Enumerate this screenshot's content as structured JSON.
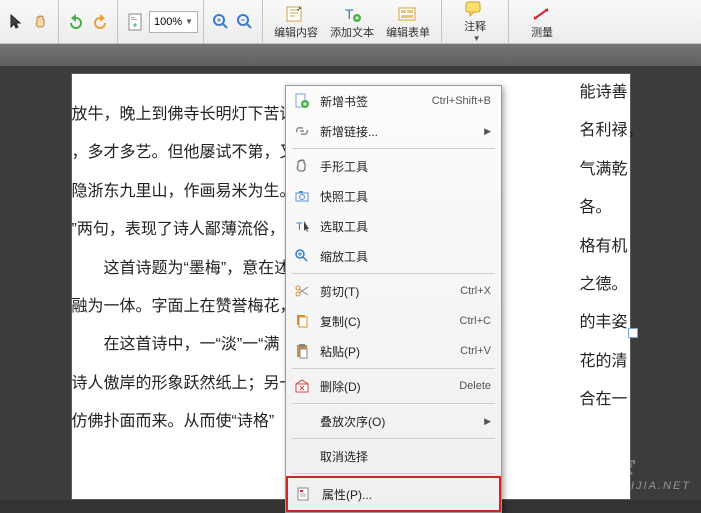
{
  "toolbar": {
    "zoom_value": "100%",
    "edit_content": "编辑内容",
    "add_text": "添加文本",
    "edit_form": "编辑表单",
    "annotate": "注释",
    "measure": "测量"
  },
  "document": {
    "lines": [
      "放牛，晚上到佛寺长明灯下苦读",
      "，多才多艺。但他屡试不第，又不",
      "隐浙东九里山，作画易米为生。",
      "”两句，表现了诗人鄙薄流俗，",
      "　　这首诗题为“墨梅”，意在述",
      "融为一体。字面上在赞誉梅花，",
      "　　在这首诗中，一“淡”一“满",
      "诗人傲岸的形象跃然纸上；另一",
      "仿佛扑面而来。从而使“诗格”"
    ],
    "tails": [
      "能诗善",
      "名利禄，",
      "气满乾",
      "各。",
      "格有机",
      "之德。",
      "的丰姿",
      "花的清",
      "合在一"
    ]
  },
  "menu": {
    "add_bookmark": "新增书签",
    "add_bookmark_sc": "Ctrl+Shift+B",
    "add_link": "新增链接...",
    "hand_tool": "手形工具",
    "snapshot_tool": "快照工具",
    "select_tool": "选取工具",
    "zoom_tool": "缩放工具",
    "cut": "剪切(T)",
    "cut_sc": "Ctrl+X",
    "copy": "复制(C)",
    "copy_sc": "Ctrl+C",
    "paste": "粘贴(P)",
    "paste_sc": "Ctrl+V",
    "delete": "删除(D)",
    "delete_sc": "Delete",
    "stacking": "叠放次序(O)",
    "deselect": "取消选择",
    "properties": "属性(P)..."
  },
  "watermark": {
    "brand": "系统之家",
    "domain": "XITONGZHIJIA.NET"
  }
}
